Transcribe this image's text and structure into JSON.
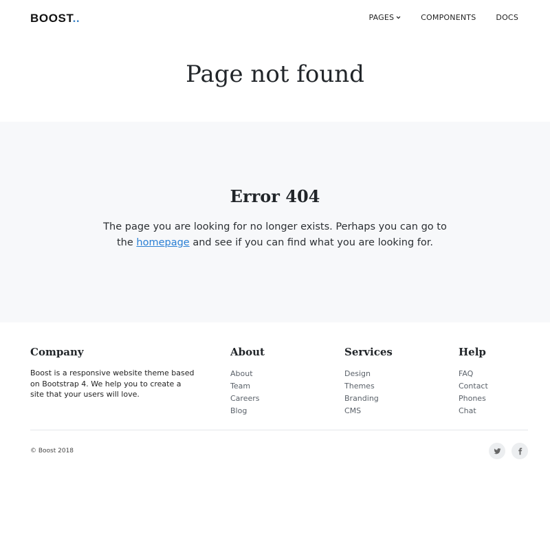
{
  "brand": {
    "name": "BOOST",
    "dots": "..",
    "accent_color": "#3b82c4"
  },
  "nav": {
    "items": [
      {
        "label": "PAGES",
        "has_dropdown": true
      },
      {
        "label": "COMPONENTS"
      },
      {
        "label": "DOCS"
      }
    ]
  },
  "page_title": "Page not found",
  "error": {
    "heading": "Error 404",
    "text_before": "The page you are looking for no longer exists. Perhaps you can go to the ",
    "link_text": "homepage",
    "text_after": " and see if you can find what you are looking for.",
    "link_color": "#2a7fd4",
    "background": "#f7f8fa"
  },
  "footer": {
    "company": {
      "heading": "Company",
      "text": "Boost is a responsive website theme based on Bootstrap 4. We help you to create a site that your users will love."
    },
    "about": {
      "heading": "About",
      "links": [
        "About",
        "Team",
        "Careers",
        "Blog"
      ]
    },
    "services": {
      "heading": "Services",
      "links": [
        "Design",
        "Themes",
        "Branding",
        "CMS"
      ]
    },
    "help": {
      "heading": "Help",
      "links": [
        "FAQ",
        "Contact",
        "Phones",
        "Chat"
      ]
    },
    "copyright": "© Boost 2018",
    "social": [
      {
        "icon": "twitter-icon"
      },
      {
        "icon": "facebook-icon"
      }
    ]
  }
}
